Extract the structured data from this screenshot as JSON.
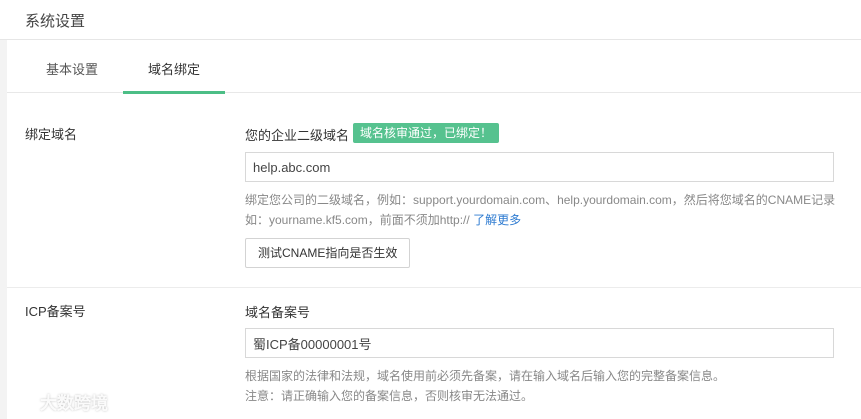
{
  "header": {
    "title": "系统设置"
  },
  "tabs": [
    {
      "label": "基本设置"
    },
    {
      "label": "域名绑定"
    }
  ],
  "domain_section": {
    "label": "绑定域名",
    "field_label": "您的企业二级域名",
    "badge": "域名核审通过，已绑定！",
    "input_value": "help.abc.com",
    "help_line1": "绑定您公司的二级域名，例如：support.yourdomain.com、help.yourdomain.com，然后将您域名的CNAME记录",
    "help_line2": "如：yourname.kf5.com，前面不须加http://",
    "learn_more": "了解更多",
    "test_button": "测试CNAME指向是否生效"
  },
  "icp_section": {
    "label": "ICP备案号",
    "field_label": "域名备案号",
    "input_value": "蜀ICP备00000001号",
    "help_line1": "根据国家的法律和法规，域名使用前必须先备案，请在输入域名后输入您的完整备案信息。",
    "help_line2": "注意：请正确输入您的备案信息，否则核审无法通过。"
  },
  "watermark": {
    "text": "大数跨境"
  }
}
